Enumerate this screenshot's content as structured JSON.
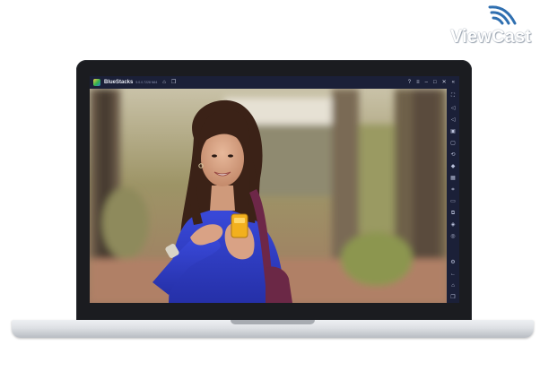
{
  "brand": {
    "logo_text": "ViewCast"
  },
  "window": {
    "app_name": "BlueStacks",
    "app_version": "5.0.0.7228 N64",
    "titlebar_icons": [
      "home-icon",
      "multi-instance-icon"
    ],
    "controls": [
      "help-icon",
      "menu-icon",
      "minimize-icon",
      "maximize-icon",
      "close-icon",
      "collapse-sidebar-icon"
    ]
  },
  "sidebar": {
    "tools": [
      "fullscreen-icon",
      "volume-up-icon",
      "volume-down-icon",
      "video-icon",
      "screen-lock-icon",
      "rotate-icon",
      "shake-icon",
      "keyboard-icon",
      "screenshot-icon",
      "folder-icon",
      "copy-icon",
      "layers-icon",
      "eco-icon",
      "settings-icon",
      "back-icon",
      "home-icon",
      "recents-icon"
    ]
  },
  "content": {
    "image_subject": "woman in blue top holding yellow phone outdoors"
  }
}
